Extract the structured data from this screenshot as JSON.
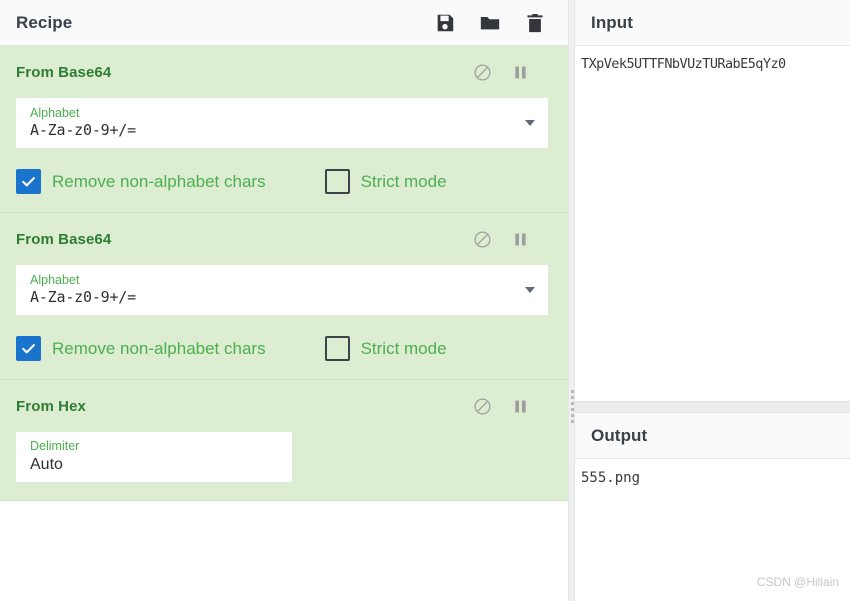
{
  "recipe": {
    "title": "Recipe",
    "actions": [
      {
        "name": "save-recipe-button",
        "icon": "save-icon",
        "label": "Save recipe"
      },
      {
        "name": "load-recipe-button",
        "icon": "folder-icon",
        "label": "Load recipe"
      },
      {
        "name": "clear-recipe-button",
        "icon": "trash-icon",
        "label": "Clear recipe"
      }
    ],
    "operations": [
      {
        "title": "From Base64",
        "disable_label": "Disable operation",
        "pause_label": "Set breakpoint",
        "field": {
          "label": "Alphabet",
          "value": "A-Za-z0-9+/=",
          "type": "select"
        },
        "checkboxes": [
          {
            "label": "Remove non-alphabet chars",
            "checked": true
          },
          {
            "label": "Strict mode",
            "checked": false
          }
        ]
      },
      {
        "title": "From Base64",
        "disable_label": "Disable operation",
        "pause_label": "Set breakpoint",
        "field": {
          "label": "Alphabet",
          "value": "A-Za-z0-9+/=",
          "type": "select"
        },
        "checkboxes": [
          {
            "label": "Remove non-alphabet chars",
            "checked": true
          },
          {
            "label": "Strict mode",
            "checked": false
          }
        ]
      },
      {
        "title": "From Hex",
        "disable_label": "Disable operation",
        "pause_label": "Set breakpoint",
        "field": {
          "label": "Delimiter",
          "value": "Auto",
          "type": "text"
        },
        "checkboxes": []
      }
    ]
  },
  "input": {
    "title": "Input",
    "value": "TXpVek5UTTFNbVUzTURabE5qYz0"
  },
  "output": {
    "title": "Output",
    "value": "555.png"
  },
  "watermark": "CSDN @Hillain",
  "colors": {
    "operation_bg": "#dcedd2",
    "operation_title": "#2e7d32",
    "field_label": "#4caf50",
    "checkbox_label": "#4caf50",
    "checkbox_checked": "#1a73cc",
    "header_bg": "#fafafa",
    "pane_title": "#3b4149"
  }
}
